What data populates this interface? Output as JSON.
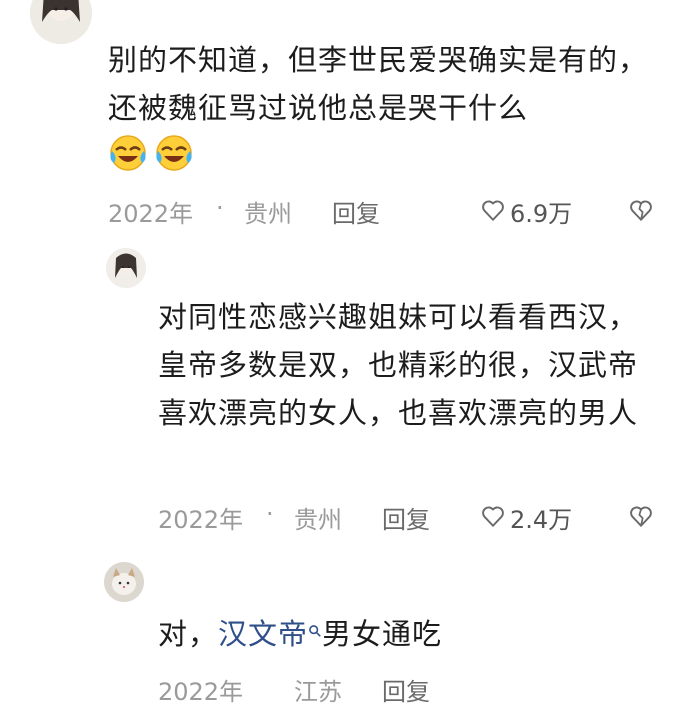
{
  "comments": [
    {
      "text": "别的不知道，但李世民爱哭确实是有的，还被魏征骂过说他总是哭干什么",
      "emojis": [
        "crying-laughing-emoji",
        "crying-laughing-emoji"
      ],
      "year": "2022年",
      "dot": "·",
      "location": "贵州",
      "reply_label": "回复",
      "likes": "6.9万"
    },
    {
      "text": "对同性恋感兴趣姐妹可以看看西汉，皇帝多数是双，也精彩的很，汉武帝喜欢漂亮的女人，也喜欢漂亮的男人",
      "year": "2022年",
      "dot": "·",
      "location": "贵州",
      "reply_label": "回复",
      "likes": "2.4万"
    },
    {
      "text_before": "对，",
      "link_text": "汉文帝",
      "text_after": "男女通吃",
      "year": "2022年",
      "location": "江苏",
      "reply_label": "回复"
    }
  ],
  "icons": {
    "like": "heart-outline-icon",
    "dislike": "broken-heart-icon",
    "search": "search-icon"
  },
  "colors": {
    "text": "#1c1c1c",
    "meta": "#9a9a9a",
    "link": "#2f4f8a"
  }
}
